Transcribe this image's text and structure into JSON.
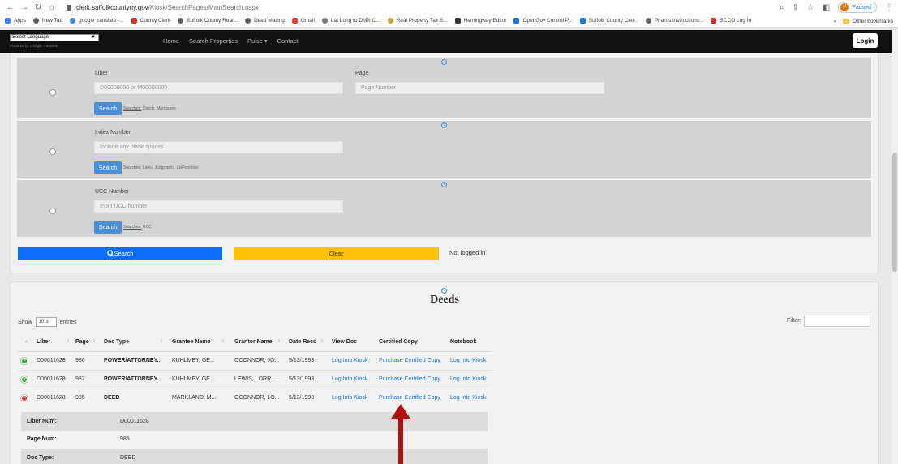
{
  "browser": {
    "url_host": "clerk.suffolkcountyny.gov",
    "url_path": "/Kiosk/SearchPages/MainSearch.aspx",
    "profile_status": "Paused",
    "profile_initial": "P",
    "bookmarks": [
      "Apps",
      "New Tab",
      "google translate -...",
      "County Clerk",
      "Suffolk County Real...",
      "Deed Mailing",
      "Gmail",
      "Lat Long to DMS C...",
      "Real Property Tax S...",
      "Hemingway Editor",
      "OpenGov Control P...",
      "Suffolk County Cler...",
      "Pharos instructions...",
      "SCCO Log In"
    ],
    "overflow": "»",
    "other_bookmarks": "Other bookmarks"
  },
  "site": {
    "language_select": "Select Language",
    "powered_by": "Powered by Google Translate",
    "nav": [
      "Home",
      "Search Properties",
      "Pulse ▾",
      "Contact"
    ],
    "login": "Login"
  },
  "search": {
    "liber": {
      "label": "Liber",
      "placeholder": "D00000000 or M00000000"
    },
    "page": {
      "label": "Page",
      "placeholder": "Page Number"
    },
    "liber_btn": "Search",
    "liber_searches_label": "Searches:",
    "liber_searches": "Deeds, Mortgages",
    "index": {
      "label": "Index Number",
      "placeholder": "Include any blank spaces"
    },
    "index_btn": "Search",
    "index_searches_label": "Searches:",
    "index_searches": "Liens, Judgments, LisPendens",
    "ucc": {
      "label": "UCC Number",
      "placeholder": "Input UCC number"
    },
    "ucc_btn": "Search",
    "ucc_searches_label": "Searches:",
    "ucc_searches": "UCC",
    "search_all": "Search",
    "clear": "Clear",
    "status": "Not logged in",
    "help": "?"
  },
  "deeds": {
    "title": "Deeds",
    "show_label": "Show",
    "show_value": "10",
    "entries_label": "entries",
    "filter_label": "Filter:",
    "columns": [
      "Liber",
      "Page",
      "Doc Type",
      "Grantee Name",
      "Grantor Name",
      "Date Recd",
      "View Doc",
      "Certified Copy",
      "Notebook"
    ],
    "rows": [
      {
        "toggle": "+",
        "liber": "D00011628",
        "page": "986",
        "doc_type": "POWER/ATTORNEY...",
        "grantee": "KUHLMEY, GE...",
        "grantor": "OCONNOR, JO...",
        "date": "5/13/1993",
        "view": "Log Into Kiosk",
        "certified": "Purchase Certified Copy",
        "notebook": "Log Into Kiosk"
      },
      {
        "toggle": "+",
        "liber": "D00011628",
        "page": "987",
        "doc_type": "POWER/ATTORNEY...",
        "grantee": "KUHLMEY, GE...",
        "grantor": "LEWIS, LORR...",
        "date": "5/13/1993",
        "view": "Log Into Kiosk",
        "certified": "Purchase Certified Copy",
        "notebook": "Log Into Kiosk"
      },
      {
        "toggle": "−",
        "liber": "D00011628",
        "page": "985",
        "doc_type": "DEED",
        "grantee": "MARKLAND, M...",
        "grantor": "OCONNOR, LO...",
        "date": "5/13/1993",
        "view": "Log Into Kiosk",
        "certified": "Purchase Certified Copy",
        "notebook": "Log Into Kiosk"
      }
    ],
    "detail": [
      {
        "label": "Liber Num:",
        "value": "D00011628"
      },
      {
        "label": "Page Num:",
        "value": "985"
      },
      {
        "label": "Doc Type:",
        "value": "DEED"
      }
    ]
  },
  "colors": {
    "primary": "#0d6efd",
    "warning": "#ffc107",
    "link": "#1a73e8",
    "arrow": "#b01010"
  }
}
